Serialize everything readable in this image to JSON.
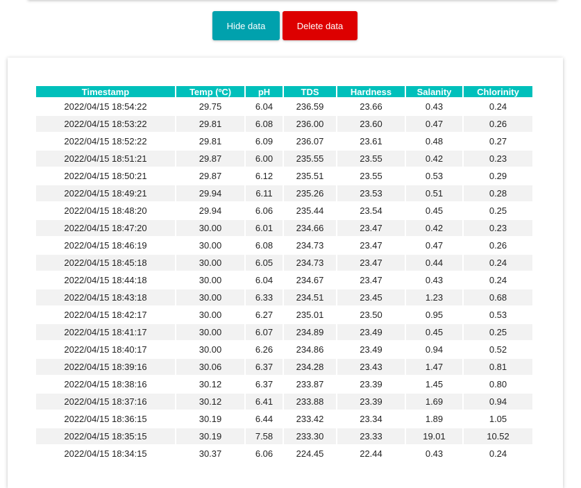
{
  "toolbar": {
    "hide_label": "Hide data",
    "delete_label": "Delete data"
  },
  "table": {
    "headers": [
      "Timestamp",
      "Temp (ºC)",
      "pH",
      "TDS",
      "Hardness",
      "Salanity",
      "Chlorinity"
    ],
    "rows": [
      [
        "2022/04/15 18:54:22",
        "29.75",
        "6.04",
        "236.59",
        "23.66",
        "0.43",
        "0.24"
      ],
      [
        "2022/04/15 18:53:22",
        "29.81",
        "6.08",
        "236.00",
        "23.60",
        "0.47",
        "0.26"
      ],
      [
        "2022/04/15 18:52:22",
        "29.81",
        "6.09",
        "236.07",
        "23.61",
        "0.48",
        "0.27"
      ],
      [
        "2022/04/15 18:51:21",
        "29.87",
        "6.00",
        "235.55",
        "23.55",
        "0.42",
        "0.23"
      ],
      [
        "2022/04/15 18:50:21",
        "29.87",
        "6.12",
        "235.51",
        "23.55",
        "0.53",
        "0.29"
      ],
      [
        "2022/04/15 18:49:21",
        "29.94",
        "6.11",
        "235.26",
        "23.53",
        "0.51",
        "0.28"
      ],
      [
        "2022/04/15 18:48:20",
        "29.94",
        "6.06",
        "235.44",
        "23.54",
        "0.45",
        "0.25"
      ],
      [
        "2022/04/15 18:47:20",
        "30.00",
        "6.01",
        "234.66",
        "23.47",
        "0.42",
        "0.23"
      ],
      [
        "2022/04/15 18:46:19",
        "30.00",
        "6.08",
        "234.73",
        "23.47",
        "0.47",
        "0.26"
      ],
      [
        "2022/04/15 18:45:18",
        "30.00",
        "6.05",
        "234.73",
        "23.47",
        "0.44",
        "0.24"
      ],
      [
        "2022/04/15 18:44:18",
        "30.00",
        "6.04",
        "234.67",
        "23.47",
        "0.43",
        "0.24"
      ],
      [
        "2022/04/15 18:43:18",
        "30.00",
        "6.33",
        "234.51",
        "23.45",
        "1.23",
        "0.68"
      ],
      [
        "2022/04/15 18:42:17",
        "30.00",
        "6.27",
        "235.01",
        "23.50",
        "0.95",
        "0.53"
      ],
      [
        "2022/04/15 18:41:17",
        "30.00",
        "6.07",
        "234.89",
        "23.49",
        "0.45",
        "0.25"
      ],
      [
        "2022/04/15 18:40:17",
        "30.00",
        "6.26",
        "234.86",
        "23.49",
        "0.94",
        "0.52"
      ],
      [
        "2022/04/15 18:39:16",
        "30.06",
        "6.37",
        "234.28",
        "23.43",
        "1.47",
        "0.81"
      ],
      [
        "2022/04/15 18:38:16",
        "30.12",
        "6.37",
        "233.87",
        "23.39",
        "1.45",
        "0.80"
      ],
      [
        "2022/04/15 18:37:16",
        "30.12",
        "6.41",
        "233.88",
        "23.39",
        "1.69",
        "0.94"
      ],
      [
        "2022/04/15 18:36:15",
        "30.19",
        "6.44",
        "233.42",
        "23.34",
        "1.89",
        "1.05"
      ],
      [
        "2022/04/15 18:35:15",
        "30.19",
        "7.58",
        "233.30",
        "23.33",
        "19.01",
        "10.52"
      ],
      [
        "2022/04/15 18:34:15",
        "30.37",
        "6.06",
        "224.45",
        "22.44",
        "0.43",
        "0.24"
      ]
    ]
  }
}
